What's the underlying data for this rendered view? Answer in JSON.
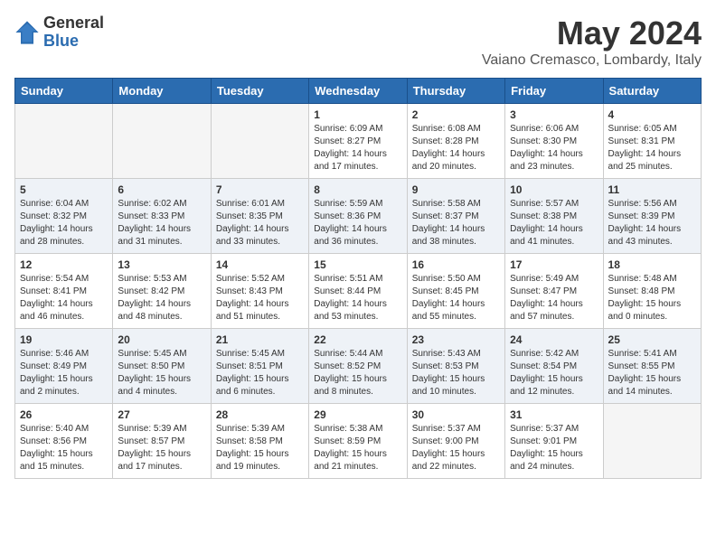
{
  "header": {
    "logo_general": "General",
    "logo_blue": "Blue",
    "month_year": "May 2024",
    "location": "Vaiano Cremasco, Lombardy, Italy"
  },
  "days_of_week": [
    "Sunday",
    "Monday",
    "Tuesday",
    "Wednesday",
    "Thursday",
    "Friday",
    "Saturday"
  ],
  "weeks": [
    [
      {
        "day": "",
        "text": ""
      },
      {
        "day": "",
        "text": ""
      },
      {
        "day": "",
        "text": ""
      },
      {
        "day": "1",
        "text": "Sunrise: 6:09 AM\nSunset: 8:27 PM\nDaylight: 14 hours\nand 17 minutes."
      },
      {
        "day": "2",
        "text": "Sunrise: 6:08 AM\nSunset: 8:28 PM\nDaylight: 14 hours\nand 20 minutes."
      },
      {
        "day": "3",
        "text": "Sunrise: 6:06 AM\nSunset: 8:30 PM\nDaylight: 14 hours\nand 23 minutes."
      },
      {
        "day": "4",
        "text": "Sunrise: 6:05 AM\nSunset: 8:31 PM\nDaylight: 14 hours\nand 25 minutes."
      }
    ],
    [
      {
        "day": "5",
        "text": "Sunrise: 6:04 AM\nSunset: 8:32 PM\nDaylight: 14 hours\nand 28 minutes."
      },
      {
        "day": "6",
        "text": "Sunrise: 6:02 AM\nSunset: 8:33 PM\nDaylight: 14 hours\nand 31 minutes."
      },
      {
        "day": "7",
        "text": "Sunrise: 6:01 AM\nSunset: 8:35 PM\nDaylight: 14 hours\nand 33 minutes."
      },
      {
        "day": "8",
        "text": "Sunrise: 5:59 AM\nSunset: 8:36 PM\nDaylight: 14 hours\nand 36 minutes."
      },
      {
        "day": "9",
        "text": "Sunrise: 5:58 AM\nSunset: 8:37 PM\nDaylight: 14 hours\nand 38 minutes."
      },
      {
        "day": "10",
        "text": "Sunrise: 5:57 AM\nSunset: 8:38 PM\nDaylight: 14 hours\nand 41 minutes."
      },
      {
        "day": "11",
        "text": "Sunrise: 5:56 AM\nSunset: 8:39 PM\nDaylight: 14 hours\nand 43 minutes."
      }
    ],
    [
      {
        "day": "12",
        "text": "Sunrise: 5:54 AM\nSunset: 8:41 PM\nDaylight: 14 hours\nand 46 minutes."
      },
      {
        "day": "13",
        "text": "Sunrise: 5:53 AM\nSunset: 8:42 PM\nDaylight: 14 hours\nand 48 minutes."
      },
      {
        "day": "14",
        "text": "Sunrise: 5:52 AM\nSunset: 8:43 PM\nDaylight: 14 hours\nand 51 minutes."
      },
      {
        "day": "15",
        "text": "Sunrise: 5:51 AM\nSunset: 8:44 PM\nDaylight: 14 hours\nand 53 minutes."
      },
      {
        "day": "16",
        "text": "Sunrise: 5:50 AM\nSunset: 8:45 PM\nDaylight: 14 hours\nand 55 minutes."
      },
      {
        "day": "17",
        "text": "Sunrise: 5:49 AM\nSunset: 8:47 PM\nDaylight: 14 hours\nand 57 minutes."
      },
      {
        "day": "18",
        "text": "Sunrise: 5:48 AM\nSunset: 8:48 PM\nDaylight: 15 hours\nand 0 minutes."
      }
    ],
    [
      {
        "day": "19",
        "text": "Sunrise: 5:46 AM\nSunset: 8:49 PM\nDaylight: 15 hours\nand 2 minutes."
      },
      {
        "day": "20",
        "text": "Sunrise: 5:45 AM\nSunset: 8:50 PM\nDaylight: 15 hours\nand 4 minutes."
      },
      {
        "day": "21",
        "text": "Sunrise: 5:45 AM\nSunset: 8:51 PM\nDaylight: 15 hours\nand 6 minutes."
      },
      {
        "day": "22",
        "text": "Sunrise: 5:44 AM\nSunset: 8:52 PM\nDaylight: 15 hours\nand 8 minutes."
      },
      {
        "day": "23",
        "text": "Sunrise: 5:43 AM\nSunset: 8:53 PM\nDaylight: 15 hours\nand 10 minutes."
      },
      {
        "day": "24",
        "text": "Sunrise: 5:42 AM\nSunset: 8:54 PM\nDaylight: 15 hours\nand 12 minutes."
      },
      {
        "day": "25",
        "text": "Sunrise: 5:41 AM\nSunset: 8:55 PM\nDaylight: 15 hours\nand 14 minutes."
      }
    ],
    [
      {
        "day": "26",
        "text": "Sunrise: 5:40 AM\nSunset: 8:56 PM\nDaylight: 15 hours\nand 15 minutes."
      },
      {
        "day": "27",
        "text": "Sunrise: 5:39 AM\nSunset: 8:57 PM\nDaylight: 15 hours\nand 17 minutes."
      },
      {
        "day": "28",
        "text": "Sunrise: 5:39 AM\nSunset: 8:58 PM\nDaylight: 15 hours\nand 19 minutes."
      },
      {
        "day": "29",
        "text": "Sunrise: 5:38 AM\nSunset: 8:59 PM\nDaylight: 15 hours\nand 21 minutes."
      },
      {
        "day": "30",
        "text": "Sunrise: 5:37 AM\nSunset: 9:00 PM\nDaylight: 15 hours\nand 22 minutes."
      },
      {
        "day": "31",
        "text": "Sunrise: 5:37 AM\nSunset: 9:01 PM\nDaylight: 15 hours\nand 24 minutes."
      },
      {
        "day": "",
        "text": ""
      }
    ]
  ]
}
